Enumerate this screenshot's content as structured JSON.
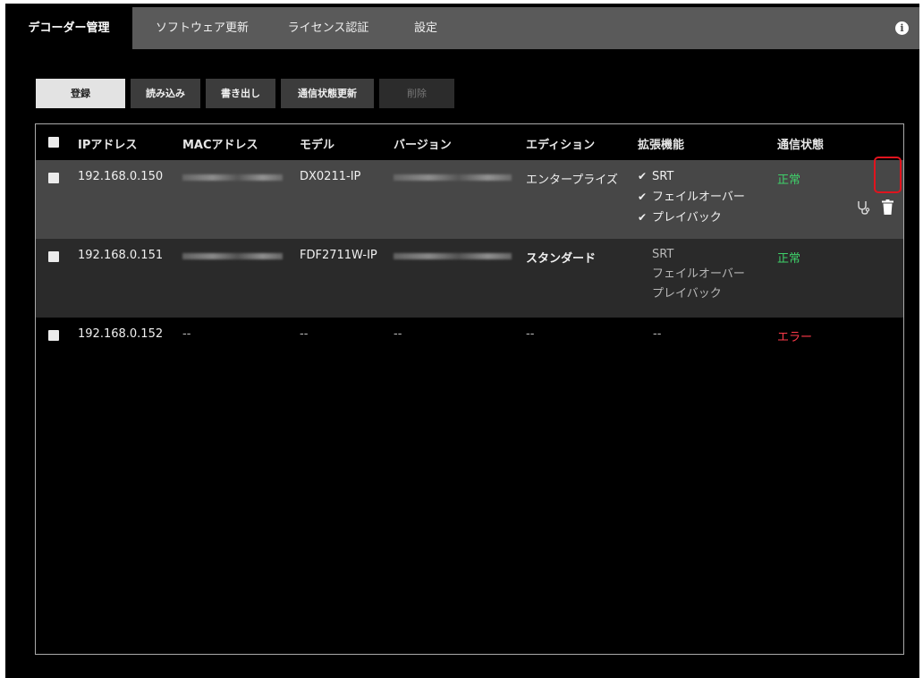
{
  "tabs": [
    {
      "label": "デコーダー管理",
      "active": true
    },
    {
      "label": "ソフトウェア更新",
      "active": false
    },
    {
      "label": "ライセンス認証",
      "active": false
    },
    {
      "label": "設定",
      "active": false
    }
  ],
  "info_icon_glyph": "i",
  "toolbar": {
    "register": "登録",
    "import": "読み込み",
    "export": "書き出し",
    "refresh_status": "通信状態更新",
    "delete": "削除"
  },
  "table": {
    "headers": [
      "IPアドレス",
      "MACアドレス",
      "モデル",
      "バージョン",
      "エディション",
      "拡張機能",
      "通信状態"
    ],
    "rows": [
      {
        "ip": "192.168.0.150",
        "mac": "",
        "model": "DX0211-IP",
        "version": "",
        "edition": "エンタープライズ",
        "features": [
          {
            "name": "SRT",
            "enabled": true
          },
          {
            "name": "フェイルオーバー",
            "enabled": true
          },
          {
            "name": "プレイバック",
            "enabled": true
          }
        ],
        "status": "正常",
        "checkmark": "✔"
      },
      {
        "ip": "192.168.0.151",
        "mac": "",
        "model": "FDF2711W-IP",
        "version": "",
        "edition": "スタンダード",
        "features": [
          {
            "name": "SRT",
            "enabled": false
          },
          {
            "name": "フェイルオーバー",
            "enabled": false
          },
          {
            "name": "プレイバック",
            "enabled": false
          }
        ],
        "status": "正常"
      },
      {
        "ip": "192.168.0.152",
        "mac": "--",
        "model": "--",
        "version": "--",
        "edition": "--",
        "features_text": "--",
        "status": "エラー"
      }
    ]
  },
  "colors": {
    "status_ok": "#3fd16a",
    "status_error": "#ff3a4a",
    "highlight": "#e0141e"
  },
  "icons": [
    "info-icon",
    "stethoscope-icon",
    "trash-icon",
    "check-icon"
  ]
}
